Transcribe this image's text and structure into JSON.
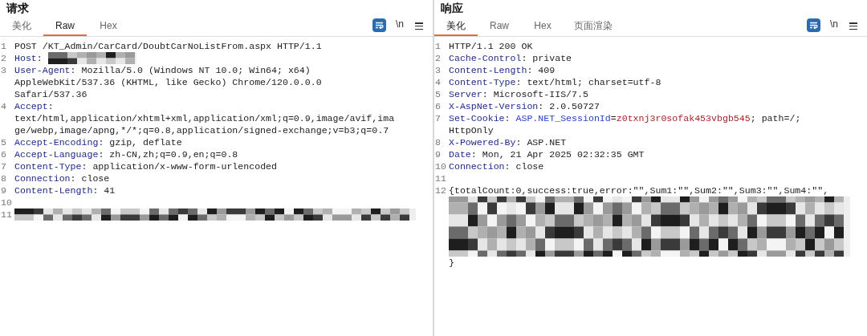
{
  "panels": [
    {
      "title": "请求",
      "tabs": [
        {
          "label": "美化",
          "selected": false
        },
        {
          "label": "Raw",
          "selected": true
        },
        {
          "label": "Hex",
          "selected": false
        }
      ],
      "toolbar": {
        "wrap_on": true,
        "newline": "\\n"
      },
      "lines": [
        {
          "number": "1",
          "rows": [
            [
              {
                "kind": "plain",
                "text": "POST /KT_Admin/CarCard/DoubtCarNoListFrom.aspx HTTP/1.1"
              }
            ]
          ]
        },
        {
          "number": "2",
          "rows": [
            [
              {
                "kind": "key",
                "text": "Host"
              },
              {
                "kind": "plain",
                "text": ": "
              },
              {
                "kind": "redacted"
              }
            ]
          ]
        },
        {
          "number": "3",
          "rows": [
            [
              {
                "kind": "key",
                "text": "User-Agent"
              },
              {
                "kind": "plain",
                "text": ": Mozilla/5.0 (Windows NT 10.0; Win64; x64)"
              }
            ],
            [
              {
                "kind": "plain",
                "text": "AppleWebKit/537.36 (KHTML, like Gecko) Chrome/120.0.0.0"
              }
            ],
            [
              {
                "kind": "plain",
                "text": "Safari/537.36"
              }
            ]
          ]
        },
        {
          "number": "4",
          "rows": [
            [
              {
                "kind": "key",
                "text": "Accept"
              },
              {
                "kind": "plain",
                "text": ":"
              }
            ],
            [
              {
                "kind": "plain",
                "text": "text/html,application/xhtml+xml,application/xml;q=0.9,image/avif,ima"
              }
            ],
            [
              {
                "kind": "plain",
                "text": "ge/webp,image/apng,*/*;q=0.8,application/signed-exchange;v=b3;q=0.7"
              }
            ]
          ]
        },
        {
          "number": "5",
          "rows": [
            [
              {
                "kind": "key",
                "text": "Accept-Encoding"
              },
              {
                "kind": "plain",
                "text": ": gzip, deflate"
              }
            ]
          ]
        },
        {
          "number": "6",
          "rows": [
            [
              {
                "kind": "key",
                "text": "Accept-Language"
              },
              {
                "kind": "plain",
                "text": ": zh-CN,zh;q=0.9,en;q=0.8"
              }
            ]
          ]
        },
        {
          "number": "7",
          "rows": [
            [
              {
                "kind": "key",
                "text": "Content-Type"
              },
              {
                "kind": "plain",
                "text": ": application/x-www-form-urlencoded"
              }
            ]
          ]
        },
        {
          "number": "8",
          "rows": [
            [
              {
                "kind": "key",
                "text": "Connection"
              },
              {
                "kind": "plain",
                "text": ": close"
              }
            ]
          ]
        },
        {
          "number": "9",
          "rows": [
            [
              {
                "kind": "key",
                "text": "Content-Length"
              },
              {
                "kind": "plain",
                "text": ": 41"
              }
            ]
          ]
        },
        {
          "number": "10",
          "rows": [
            []
          ]
        },
        {
          "number": "11",
          "rows": [
            [
              {
                "kind": "redacted"
              }
            ]
          ]
        }
      ]
    },
    {
      "title": "响应",
      "tabs": [
        {
          "label": "美化",
          "selected": true
        },
        {
          "label": "Raw",
          "selected": false
        },
        {
          "label": "Hex",
          "selected": false
        },
        {
          "label": "页面渲染",
          "selected": false
        }
      ],
      "toolbar": {
        "wrap_on": true,
        "newline": "\\n"
      },
      "lines": [
        {
          "number": "1",
          "rows": [
            [
              {
                "kind": "plain",
                "text": "HTTP/1.1 200 OK"
              }
            ]
          ]
        },
        {
          "number": "2",
          "rows": [
            [
              {
                "kind": "key",
                "text": "Cache-Control"
              },
              {
                "kind": "plain",
                "text": ": private"
              }
            ]
          ]
        },
        {
          "number": "3",
          "rows": [
            [
              {
                "kind": "key",
                "text": "Content-Length"
              },
              {
                "kind": "plain",
                "text": ": 409"
              }
            ]
          ]
        },
        {
          "number": "4",
          "rows": [
            [
              {
                "kind": "key",
                "text": "Content-Type"
              },
              {
                "kind": "plain",
                "text": ": text/html; charset=utf-8"
              }
            ]
          ]
        },
        {
          "number": "5",
          "rows": [
            [
              {
                "kind": "key",
                "text": "Server"
              },
              {
                "kind": "plain",
                "text": ": Microsoft-IIS/7.5"
              }
            ]
          ]
        },
        {
          "number": "6",
          "rows": [
            [
              {
                "kind": "key",
                "text": "X-AspNet-Version"
              },
              {
                "kind": "plain",
                "text": ": 2.0.50727"
              }
            ]
          ]
        },
        {
          "number": "7",
          "rows": [
            [
              {
                "kind": "key",
                "text": "Set-Cookie"
              },
              {
                "kind": "plain",
                "text": ": "
              },
              {
                "kind": "cookie-name",
                "text": "ASP.NET_SessionId"
              },
              {
                "kind": "plain",
                "text": "="
              },
              {
                "kind": "cookie-value",
                "text": "z0txnj3r0sofak453vbgb545"
              },
              {
                "kind": "plain",
                "text": "; path=/;"
              }
            ],
            [
              {
                "kind": "plain",
                "text": "HttpOnly"
              }
            ]
          ]
        },
        {
          "number": "8",
          "rows": [
            [
              {
                "kind": "key",
                "text": "X-Powered-By"
              },
              {
                "kind": "plain",
                "text": ": ASP.NET"
              }
            ]
          ]
        },
        {
          "number": "9",
          "rows": [
            [
              {
                "kind": "key",
                "text": "Date"
              },
              {
                "kind": "plain",
                "text": ": Mon, 21 Apr 2025 02:32:35 GMT"
              }
            ]
          ]
        },
        {
          "number": "10",
          "rows": [
            [
              {
                "kind": "key",
                "text": "Connection"
              },
              {
                "kind": "plain",
                "text": ": close"
              }
            ]
          ]
        },
        {
          "number": "11",
          "rows": [
            []
          ]
        },
        {
          "number": "12",
          "rows": [
            [
              {
                "kind": "plain",
                "text": "{totalCount:0,success:true,error:\"\",Sum1:\"\",Sum2:\"\",Sum3:\"\",Sum4:\"\","
              }
            ],
            [
              {
                "kind": "redacted"
              }
            ],
            [
              {
                "kind": "redacted"
              }
            ],
            [
              {
                "kind": "redacted"
              }
            ],
            [
              {
                "kind": "redacted"
              }
            ],
            [
              {
                "kind": "redacted"
              }
            ],
            [
              {
                "kind": "plain",
                "text": "}"
              }
            ]
          ]
        }
      ]
    }
  ]
}
